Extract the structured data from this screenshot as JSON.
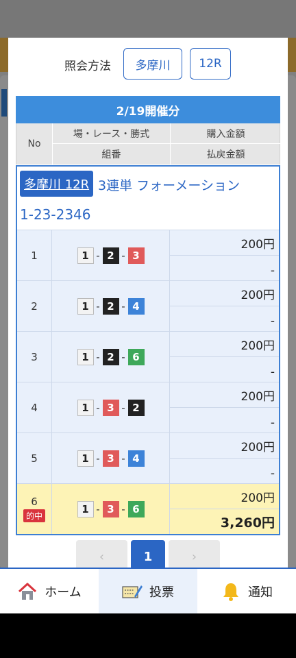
{
  "modal": {
    "method_label": "照会方法",
    "venue_button": "多摩川",
    "race_button": "12R"
  },
  "table": {
    "date_header": "2/19開催分",
    "col_no": "No",
    "col_venue_race_type": "場・レース・勝式",
    "col_combination": "組番",
    "col_purchase_amount": "購入金額",
    "col_refund_amount": "払戻金額"
  },
  "bet": {
    "venue_race": "多摩川 12R",
    "bet_type": "3連単 フォーメーション",
    "combination": "1-23-2346",
    "rows": [
      {
        "no": "1",
        "nums": [
          "1",
          "2",
          "3"
        ],
        "amount": "200円",
        "payout": "-",
        "hit": false
      },
      {
        "no": "2",
        "nums": [
          "1",
          "2",
          "4"
        ],
        "amount": "200円",
        "payout": "-",
        "hit": false
      },
      {
        "no": "3",
        "nums": [
          "1",
          "2",
          "6"
        ],
        "amount": "200円",
        "payout": "-",
        "hit": false
      },
      {
        "no": "4",
        "nums": [
          "1",
          "3",
          "2"
        ],
        "amount": "200円",
        "payout": "-",
        "hit": false
      },
      {
        "no": "5",
        "nums": [
          "1",
          "3",
          "4"
        ],
        "amount": "200円",
        "payout": "-",
        "hit": false
      },
      {
        "no": "6",
        "nums": [
          "1",
          "3",
          "6"
        ],
        "amount": "200円",
        "payout": "3,260円",
        "hit": true
      }
    ],
    "hit_label": "的中"
  },
  "pager": {
    "prev": "‹",
    "current": "1",
    "next": "›"
  },
  "nav": {
    "home": "ホーム",
    "vote": "投票",
    "notify": "通知"
  },
  "colors": {
    "accent": "#2b66c4",
    "header_blue": "#3d8ddc",
    "hit_bg": "#fdf3b6",
    "hit_badge": "#d9343d"
  }
}
